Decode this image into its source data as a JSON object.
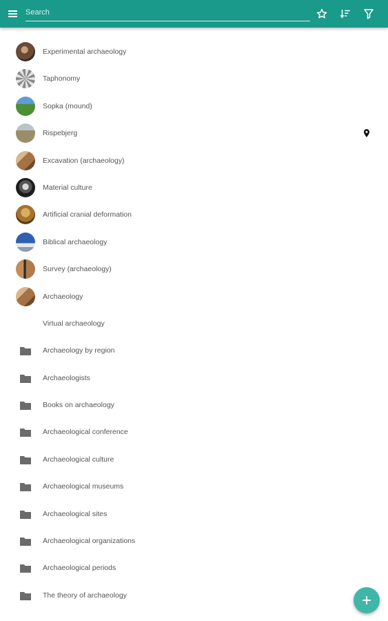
{
  "toolbar": {
    "search_placeholder": "Search",
    "menu_icon": "menu-icon",
    "star_icon": "star-outline-icon",
    "sort_icon": "sort-icon",
    "filter_icon": "filter-icon"
  },
  "colors": {
    "appbar": "#1a9a8a",
    "fab": "#3fb6a8",
    "folder": "#6b6b6b"
  },
  "articles": [
    {
      "label": "Experimental archaeology",
      "icon": "photo-thumbnail"
    },
    {
      "label": "Taphonomy",
      "icon": "photo-thumbnail"
    },
    {
      "label": "Sopka (mound)",
      "icon": "photo-thumbnail"
    },
    {
      "label": "Rispebjerg",
      "icon": "photo-thumbnail",
      "location_icon": "map-pin-icon"
    },
    {
      "label": "Excavation (archaeology)",
      "icon": "photo-thumbnail"
    },
    {
      "label": "Material culture",
      "icon": "photo-thumbnail"
    },
    {
      "label": "Artificial cranial deformation",
      "icon": "photo-thumbnail"
    },
    {
      "label": "Biblical archaeology",
      "icon": "photo-thumbnail"
    },
    {
      "label": "Survey (archaeology)",
      "icon": "photo-thumbnail"
    },
    {
      "label": "Archaeology",
      "icon": "photo-thumbnail"
    },
    {
      "label": "Virtual archaeology",
      "icon": "none"
    }
  ],
  "categories": [
    {
      "label": "Archaeology by region",
      "icon": "folder-icon"
    },
    {
      "label": "Archaeologists",
      "icon": "folder-icon"
    },
    {
      "label": "Books on archaeology",
      "icon": "folder-icon"
    },
    {
      "label": "Archaeological conference",
      "icon": "folder-icon"
    },
    {
      "label": "Archaeological culture",
      "icon": "folder-icon"
    },
    {
      "label": "Archaeological museums",
      "icon": "folder-icon"
    },
    {
      "label": "Archaeological sites",
      "icon": "folder-icon"
    },
    {
      "label": "Archaeological organizations",
      "icon": "folder-icon"
    },
    {
      "label": "Archaeological periods",
      "icon": "folder-icon"
    },
    {
      "label": "The theory of archaeology",
      "icon": "folder-icon"
    }
  ],
  "fab": {
    "icon": "plus-icon"
  }
}
